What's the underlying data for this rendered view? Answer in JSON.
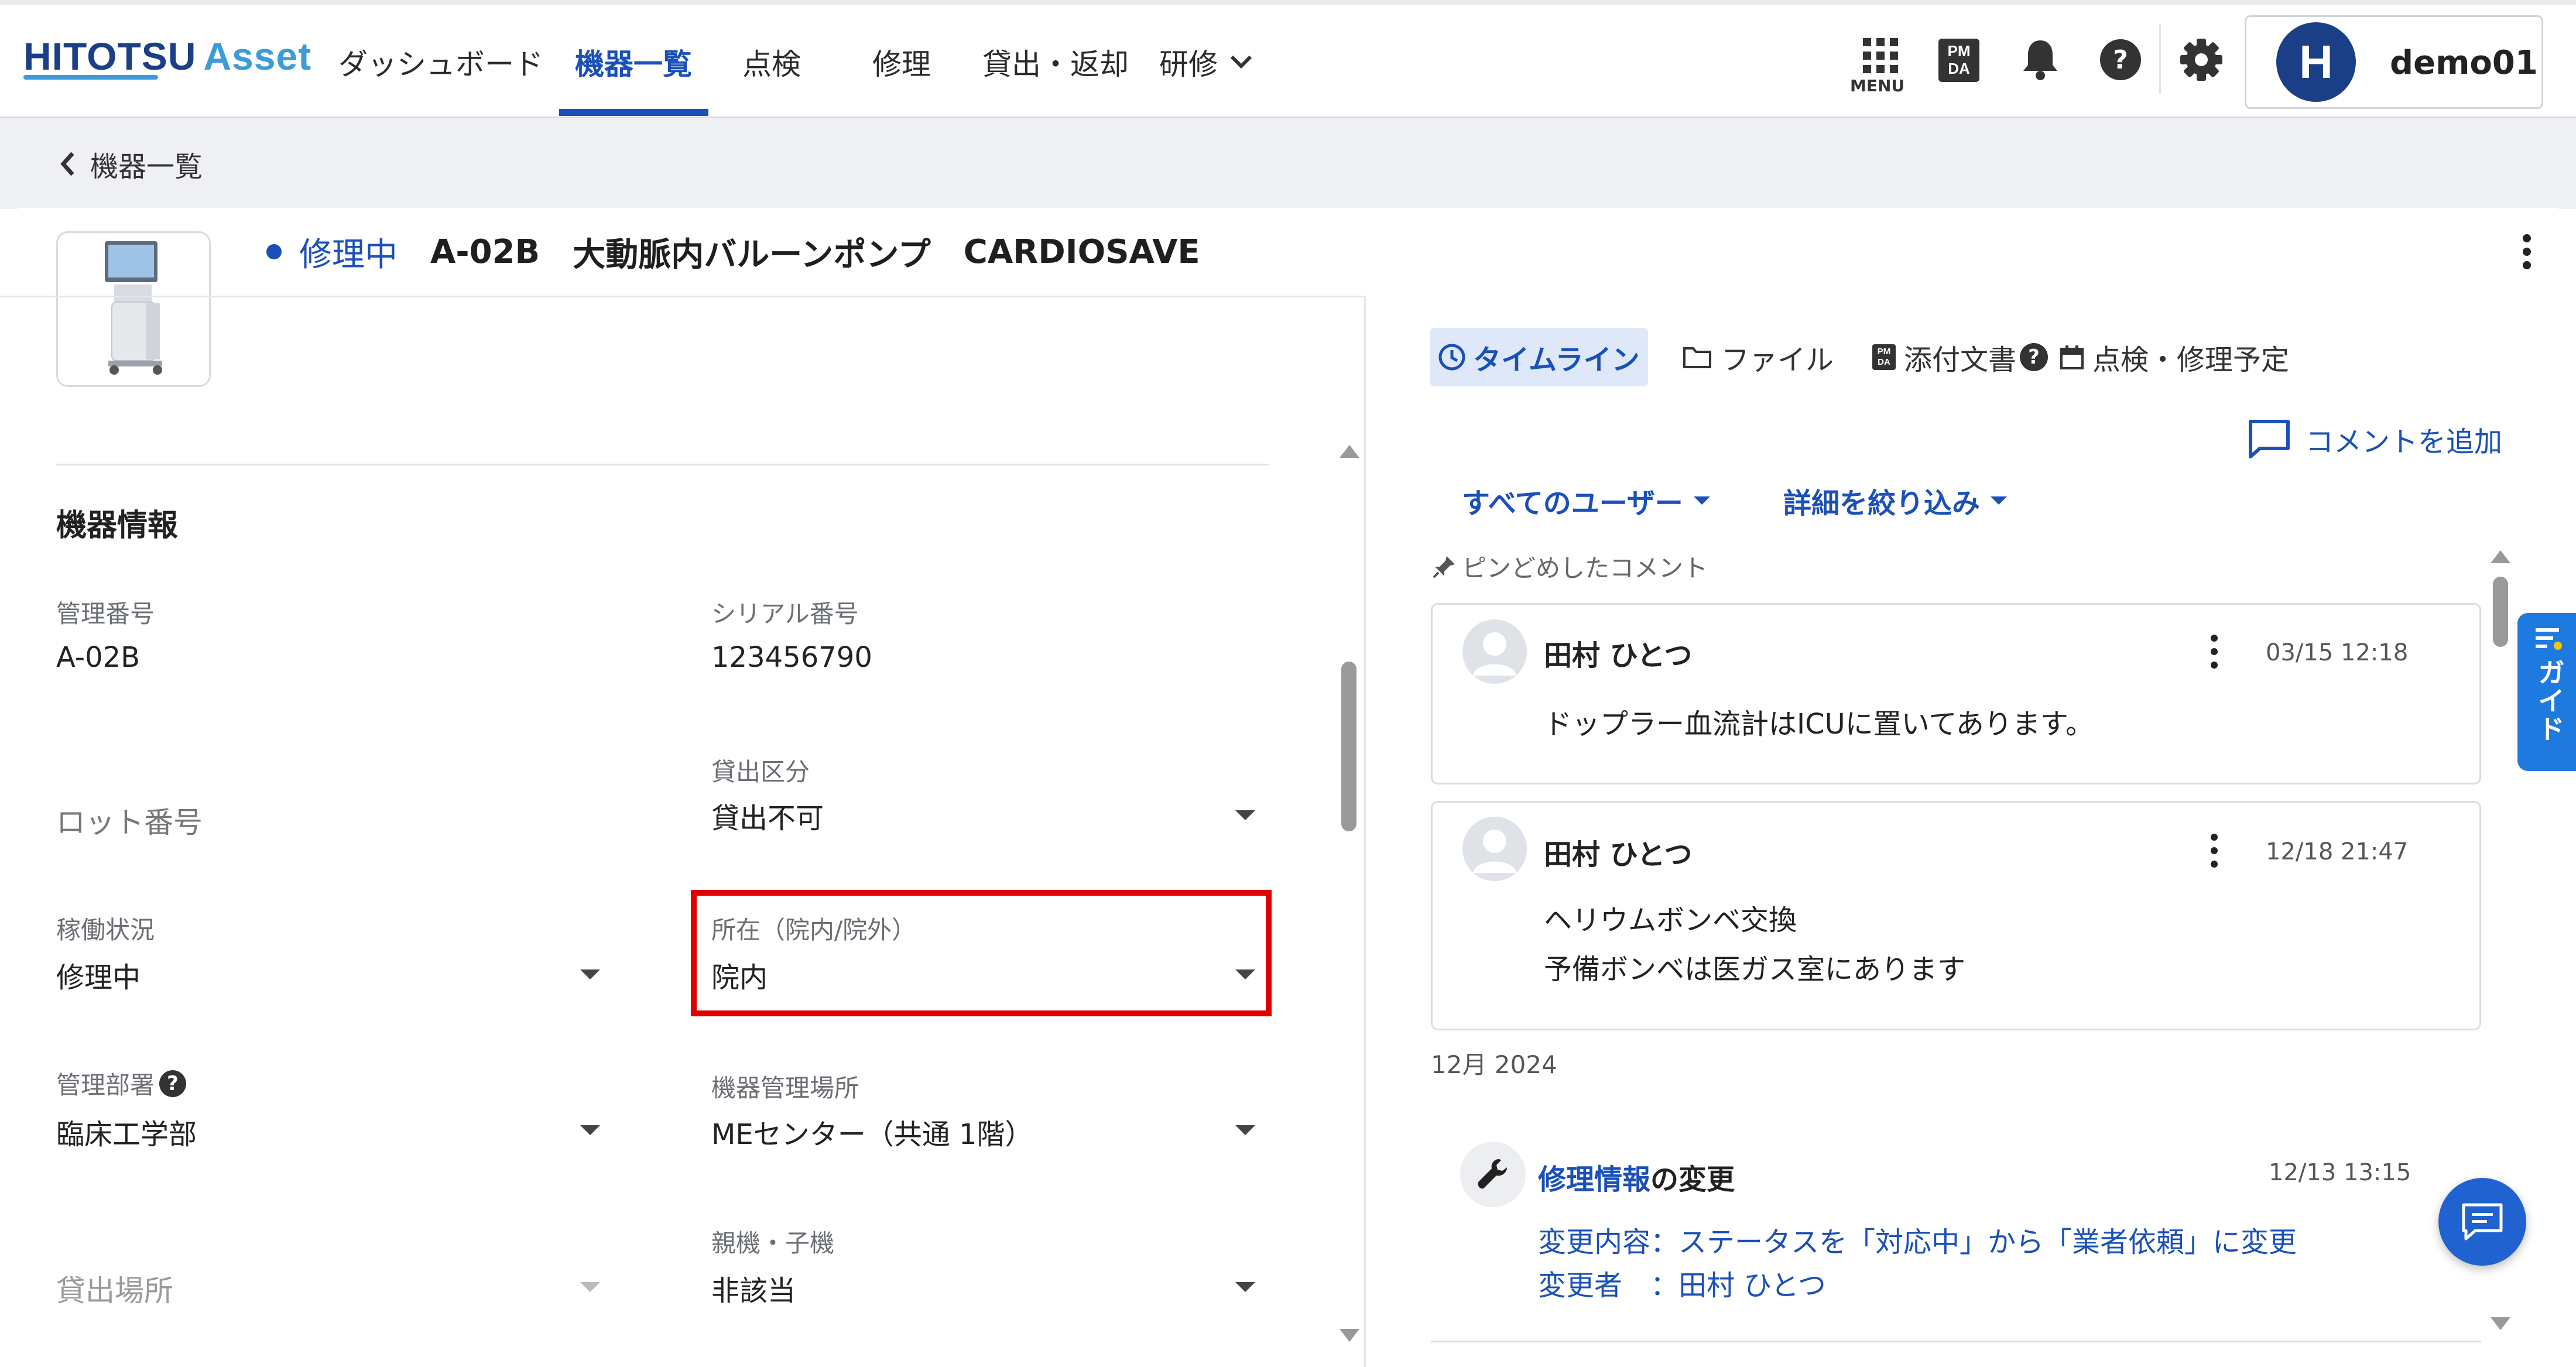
{
  "brand": {
    "part1": "HITOTSU",
    "part2": "Asset"
  },
  "nav": {
    "items": [
      {
        "label": "ダッシュボード"
      },
      {
        "label": "機器一覧"
      },
      {
        "label": "点検"
      },
      {
        "label": "修理"
      },
      {
        "label": "貸出・返却"
      },
      {
        "label": "研修"
      }
    ],
    "active_index": 1,
    "menu_label": "MENU",
    "pmda_label_top": "PM",
    "pmda_label_bottom": "DA",
    "username": "demo01",
    "avatar_letter": "H"
  },
  "breadcrumb": {
    "back_label": "機器一覧"
  },
  "header": {
    "status": "修理中",
    "management_no": "A-02B",
    "device_name": "大動脈内バルーンポンプ",
    "model": "CARDIOSAVE",
    "status_color": "#1a50b8"
  },
  "device_info": {
    "section_title": "機器情報",
    "fields": {
      "management_no": {
        "label": "管理番号",
        "value": "A-02B"
      },
      "serial_no": {
        "label": "シリアル番号",
        "value": "123456790"
      },
      "lot_no": {
        "label": "ロット番号",
        "value": ""
      },
      "lending_class": {
        "label": "貸出区分",
        "value": "貸出不可"
      },
      "operation_status": {
        "label": "稼働状況",
        "value": "修理中"
      },
      "location_inout": {
        "label": "所在（院内/院外）",
        "value": "院内"
      },
      "managing_dept": {
        "label": "管理部署",
        "value": "臨床工学部"
      },
      "managed_place": {
        "label": "機器管理場所",
        "value": "MEセンター（共通 1階）"
      },
      "lending_place": {
        "label": "貸出場所",
        "value": ""
      },
      "parent_child": {
        "label": "親機・子機",
        "value": "非該当"
      }
    }
  },
  "right_panel": {
    "tabs": [
      {
        "label": "タイムライン",
        "icon": "clock-icon"
      },
      {
        "label": "ファイル",
        "icon": "folder-icon"
      },
      {
        "label": "添付文書",
        "icon": "pmda-icon"
      },
      {
        "label": "点検・修理予定",
        "icon": "calendar-icon"
      }
    ],
    "active_tab": 0,
    "add_comment_label": "コメントを追加",
    "filters": {
      "users": "すべてのユーザー",
      "details": "詳細を絞り込み"
    },
    "pinned_label": "ピンどめしたコメント",
    "comments": [
      {
        "author": "田村 ひとつ",
        "time": "03/15 12:18",
        "lines": [
          "ドップラー血流計はICUに置いてあります。"
        ]
      },
      {
        "author": "田村 ひとつ",
        "time": "12/18 21:47",
        "lines": [
          "ヘリウムボンベ交換",
          "予備ボンベは医ガス室にあります"
        ]
      }
    ],
    "month_label": "12月 2024",
    "change_event": {
      "title_link": "修理情報",
      "title_rest": "の変更",
      "time": "12/13 13:15",
      "line1": "変更内容：ステータスを「対応中」から「業者依頼」に変更",
      "line2": "変更者　：田村 ひとつ"
    },
    "guide_label": "ガイド"
  },
  "colors": {
    "accent": "#1a50b8",
    "brand_dark": "#1b3f86",
    "brand_light": "#3c9bd8",
    "highlight": "#e00000"
  }
}
